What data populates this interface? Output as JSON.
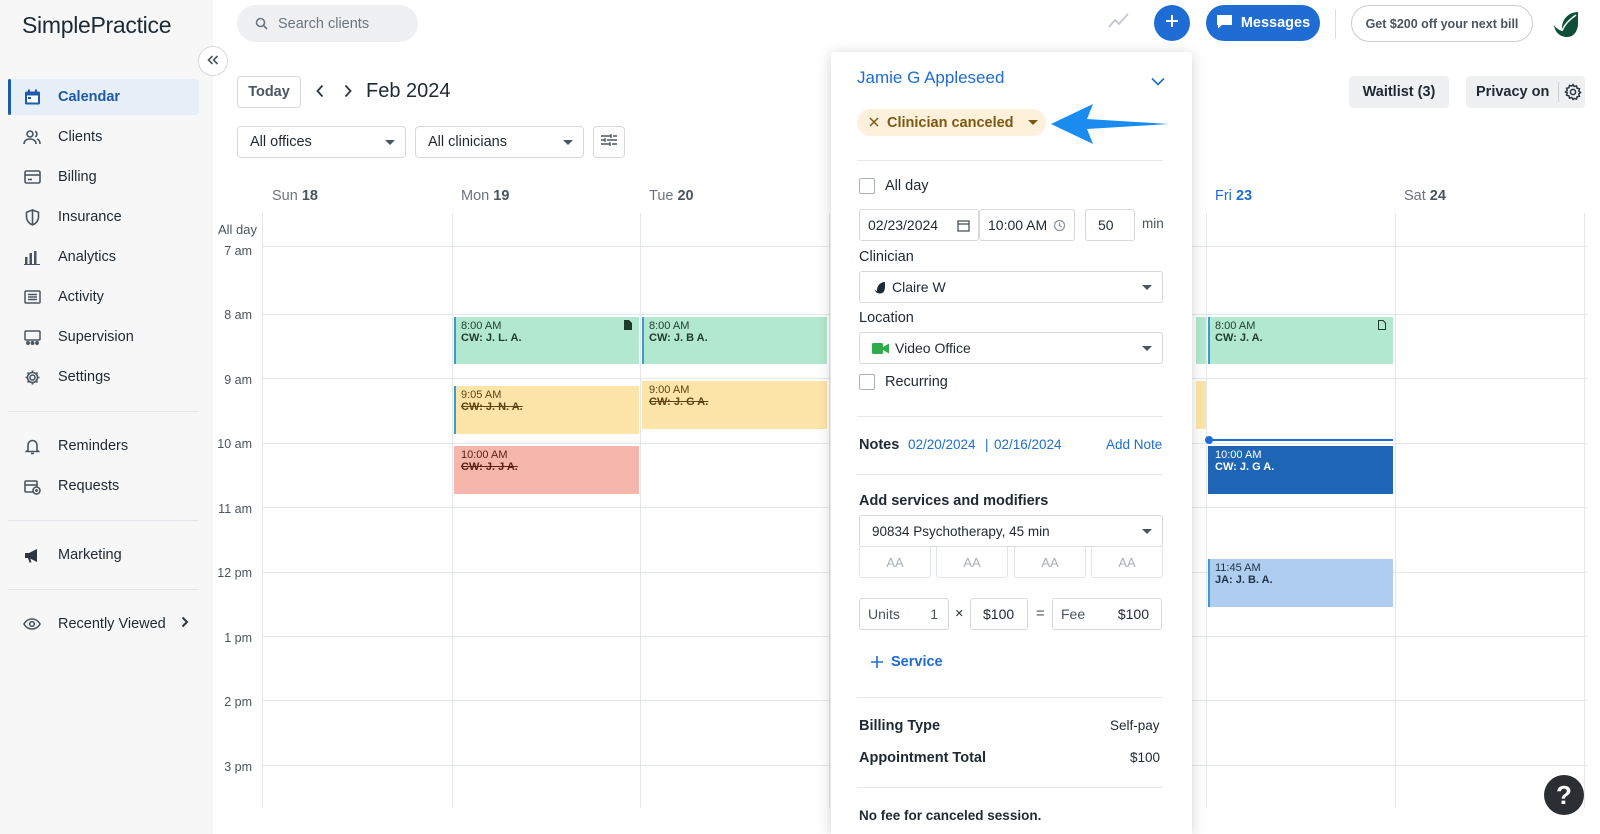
{
  "app": {
    "logo": "SimplePractice"
  },
  "sidebar": {
    "items": [
      {
        "label": "Calendar",
        "icon": "calendar-icon",
        "active": true
      },
      {
        "label": "Clients",
        "icon": "clients-icon"
      },
      {
        "label": "Billing",
        "icon": "billing-icon"
      },
      {
        "label": "Insurance",
        "icon": "shield-icon"
      },
      {
        "label": "Analytics",
        "icon": "analytics-icon"
      },
      {
        "label": "Activity",
        "icon": "activity-icon"
      },
      {
        "label": "Supervision",
        "icon": "supervision-icon"
      },
      {
        "label": "Settings",
        "icon": "gear-icon"
      }
    ],
    "secondary": [
      {
        "label": "Reminders",
        "icon": "bell-icon"
      },
      {
        "label": "Requests",
        "icon": "requests-icon"
      }
    ],
    "marketing": {
      "label": "Marketing",
      "icon": "megaphone-icon"
    },
    "recent": {
      "label": "Recently Viewed",
      "icon": "eye-icon"
    }
  },
  "topbar": {
    "search_placeholder": "Search clients",
    "messages_label": "Messages",
    "promo_label": "Get $200 off your next bill"
  },
  "calendar": {
    "today_label": "Today",
    "month_label": "Feb 2024",
    "office_select": "All offices",
    "clinician_select": "All clinicians",
    "waitlist_label": "Waitlist (3)",
    "privacy_label": "Privacy on",
    "allday_label": "All day",
    "days": [
      {
        "name": "Sun",
        "num": "18"
      },
      {
        "name": "Mon",
        "num": "19"
      },
      {
        "name": "Tue",
        "num": "20"
      },
      {
        "name": "Fri",
        "num": "23",
        "today": true
      },
      {
        "name": "Sat",
        "num": "24"
      }
    ],
    "times": [
      "7 am",
      "8 am",
      "9 am",
      "10 am",
      "11 am",
      "12 pm",
      "1 pm",
      "2 pm",
      "3 pm"
    ],
    "events": [
      {
        "time": "8:00 AM",
        "name": "CW: J. L. A.",
        "color": "#b2e8cf",
        "border": "#3a9bd0",
        "doc": true
      },
      {
        "time": "8:00 AM",
        "name": "CW: J. B A.",
        "color": "#b2e8cf",
        "border": "#3a9bd0"
      },
      {
        "time": "9:05 AM",
        "name": "CW: J. N. A.",
        "color": "#fde5a9",
        "border": "#3a9bd0",
        "canceled": true
      },
      {
        "time": "9:00 AM",
        "name": "CW: J. G A.",
        "color": "#fde5a9",
        "border": "#fde5a9",
        "canceled": true
      },
      {
        "time": "10:00 AM",
        "name": "CW: J. J A.",
        "color": "#f6b6ab",
        "border": "#f6b6ab",
        "canceled": true
      },
      {
        "time": "8:00 AM",
        "name": "CW: J. A.",
        "color": "#b2e8cf",
        "border": "#3a9bd0",
        "doc": true
      },
      {
        "time": "10:00 AM",
        "name": "CW: J. G A.",
        "color": "#1e66b5",
        "border": "#1e66b5",
        "selected": true
      },
      {
        "time": "11:45 AM",
        "name": "JA: J. B. A.",
        "color": "#aecdef",
        "border": "#3a9bd0"
      }
    ]
  },
  "appointment": {
    "client_name": "Jamie G Appleseed",
    "status": "Clinician canceled",
    "all_day_label": "All day",
    "date": "02/23/2024",
    "time": "10:00 AM",
    "duration": "50",
    "duration_unit": "min",
    "clinician_label": "Clinician",
    "clinician": "Claire W",
    "location_label": "Location",
    "location": "Video Office",
    "recurring_label": "Recurring",
    "notes_label": "Notes",
    "note_dates": [
      "02/20/2024",
      "02/16/2024"
    ],
    "note_sep": "|",
    "add_note": "Add Note",
    "services_label": "Add services and modifiers",
    "service": "90834 Psychotherapy, 45 min",
    "modifiers": [
      "AA",
      "AA",
      "AA",
      "AA"
    ],
    "units_label": "Units",
    "units": "1",
    "times_sign": "×",
    "rate": "$100",
    "equals_sign": "=",
    "fee_label": "Fee",
    "fee": "$100",
    "add_service": "Service",
    "billing_type_label": "Billing Type",
    "billing_type": "Self-pay",
    "total_label": "Appointment Total",
    "total": "$100",
    "no_fee_note": "No fee for canceled session."
  },
  "help_label": "?"
}
